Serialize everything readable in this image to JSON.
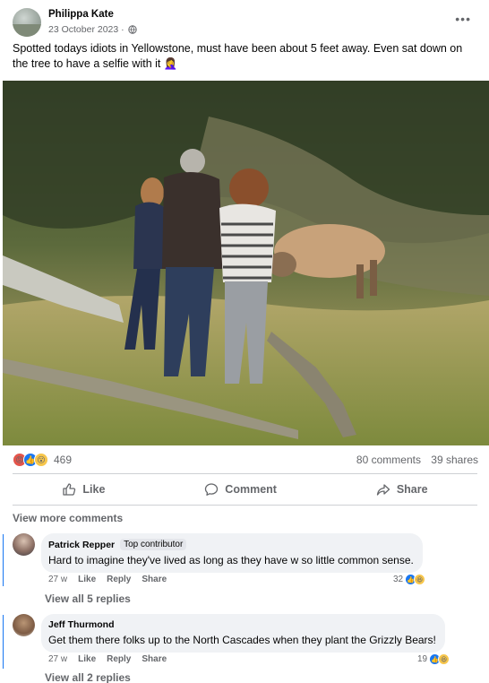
{
  "post": {
    "author": "Philippa Kate",
    "date": "23 October 2023 ·",
    "text": "Spotted todays idiots in Yellowstone, must have been about 5 feet away. Even sat down on the tree to have a selfie with it 🤦‍♀️",
    "privacy_icon": "globe-icon",
    "more_icon": "more-horizontal-icon"
  },
  "stats": {
    "reaction_icons": [
      "angry",
      "like",
      "wow"
    ],
    "reaction_count": "469",
    "comments": "80 comments",
    "shares": "39 shares"
  },
  "actions": {
    "like": "Like",
    "comment": "Comment",
    "share": "Share"
  },
  "comments_section": {
    "view_more": "View more comments",
    "items": [
      {
        "name": "Patrick Repper",
        "badge": "Top contributor",
        "text": "Hard to imagine they've lived as long as they have w so little common sense.",
        "time": "27 w",
        "like": "Like",
        "reply": "Reply",
        "share": "Share",
        "reaction_count": "32",
        "view_replies": "View all 5 replies"
      },
      {
        "name": "Jeff Thurmond",
        "text": "Get them there folks up to the North Cascades when they plant the Grizzly Bears!",
        "time": "27 w",
        "like": "Like",
        "reply": "Reply",
        "share": "Share",
        "reaction_count": "19",
        "view_replies": "View all 2 replies"
      }
    ]
  },
  "colors": {
    "brand_blue": "#1877f2",
    "secondary_text": "#65676b",
    "bubble_bg": "#f0f2f5"
  }
}
